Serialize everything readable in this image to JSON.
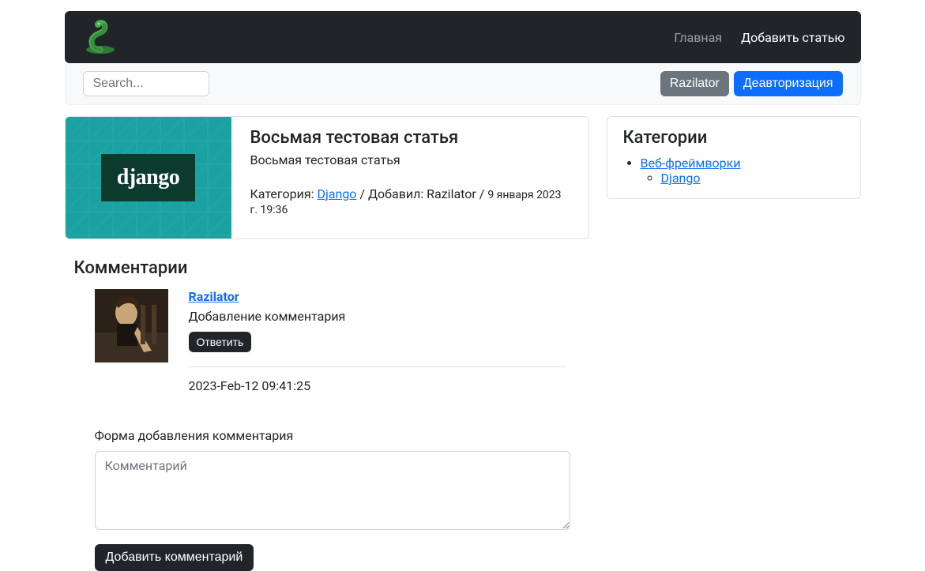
{
  "nav": {
    "link_home": "Главная",
    "link_add": "Добавить статью"
  },
  "subbar": {
    "search_placeholder": "Search...",
    "user_btn": "Razilator",
    "logout_btn": "Деавторизация"
  },
  "article": {
    "title": "Восьмая тестовая статья",
    "desc": "Восьмая тестовая статья",
    "thumb_label": "django",
    "meta_category_label": "Категория: ",
    "category_link": "Django",
    "meta_sep": " / ",
    "added_by_label": "Добавил: ",
    "added_by_user": "Razilator",
    "date": "9 января 2023 г. 19:36"
  },
  "sidebar": {
    "title": "Категории",
    "items": [
      {
        "label": "Веб-фреймворки",
        "children": [
          {
            "label": "Django"
          }
        ]
      }
    ]
  },
  "comments": {
    "title": "Комментарии",
    "list": [
      {
        "author": "Razilator",
        "text": "Добавление комментария",
        "reply_btn": "Ответить",
        "time": "2023-Feb-12 09:41:25"
      }
    ]
  },
  "form": {
    "label": "Форма добавления комментария",
    "placeholder": "Комментарий",
    "submit": "Добавить комментарий"
  }
}
